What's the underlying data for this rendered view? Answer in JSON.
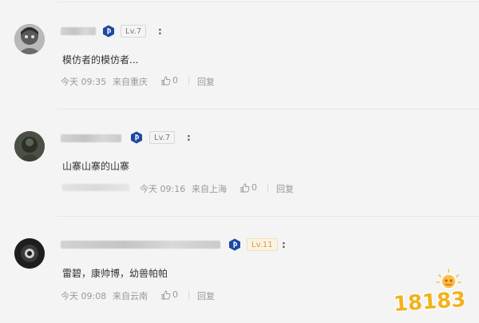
{
  "comments": [
    {
      "level": "Lv.7",
      "colon": ":",
      "text": "模仿者的模仿者...",
      "time": "今天 09:35",
      "location": "来自重庆",
      "likes": "0",
      "reply": "回复"
    },
    {
      "level": "Lv.7",
      "colon": ":",
      "text": "山寨山寨的山寨",
      "time": "今天 09:16",
      "location": "来自上海",
      "likes": "0",
      "reply": "回复"
    },
    {
      "level": "Lv.11",
      "colon": ":",
      "text": "雷碧，康帅博，幼兽帕帕",
      "time": "今天 09:08",
      "location": "来自云南",
      "likes": "0",
      "reply": "回复"
    }
  ],
  "watermark": {
    "text": "18183"
  },
  "icons": {
    "badge": "playstation-badge-icon",
    "like": "thumbs-up-icon"
  },
  "colors": {
    "badge_bg": "#1c4aa0",
    "gold_level": "#d99c38"
  }
}
